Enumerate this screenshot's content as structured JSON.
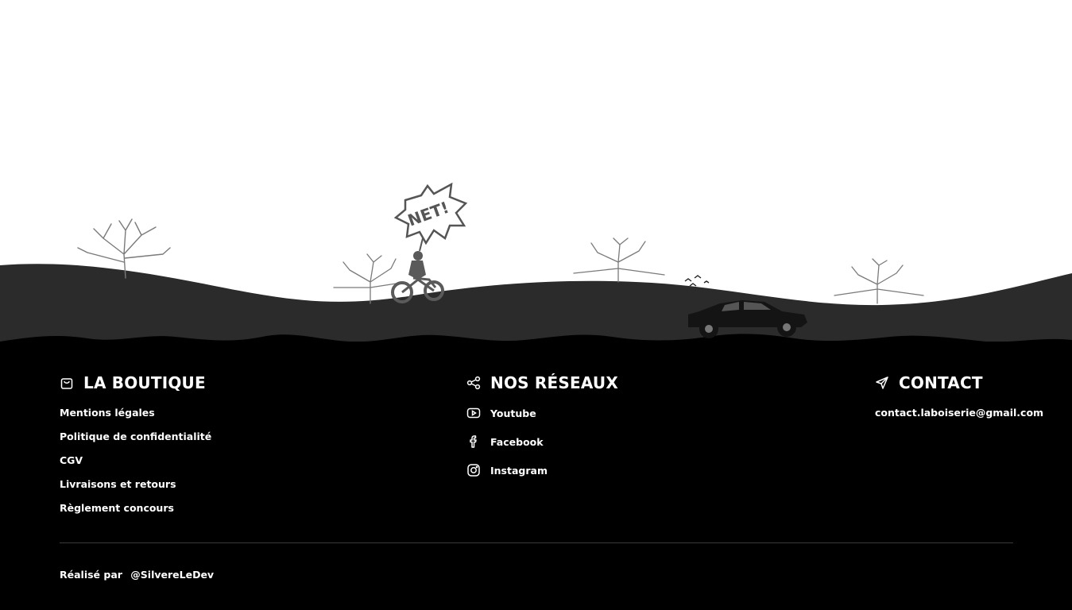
{
  "footer": {
    "boutique": {
      "title": "LA BOUTIQUE",
      "icon": "shopping-bag-icon",
      "links": [
        {
          "label": "Mentions légales"
        },
        {
          "label": "Politique de confidentialité"
        },
        {
          "label": "CGV"
        },
        {
          "label": "Livraisons et retours"
        },
        {
          "label": "Règlement concours"
        }
      ]
    },
    "reseaux": {
      "title": "NOS RÉSEAUX",
      "icon": "share-icon",
      "links": [
        {
          "label": "Youtube",
          "icon": "youtube-icon"
        },
        {
          "label": "Facebook",
          "icon": "facebook-icon"
        },
        {
          "label": "Instagram",
          "icon": "instagram-icon"
        }
      ]
    },
    "contact": {
      "title": "CONTACT",
      "icon": "send-icon",
      "email": "contact.laboiserie@gmail.com"
    },
    "credit": {
      "prefix": "Réalisé par",
      "author": "@SilvereLeDev"
    }
  },
  "scene": {
    "speech_bubble_text": "NET!",
    "colors": {
      "hill_back": "#2b2b2b",
      "ground": "#000000",
      "trees": "#7a7a7a",
      "silhouettes": "#1a1a1a"
    }
  }
}
